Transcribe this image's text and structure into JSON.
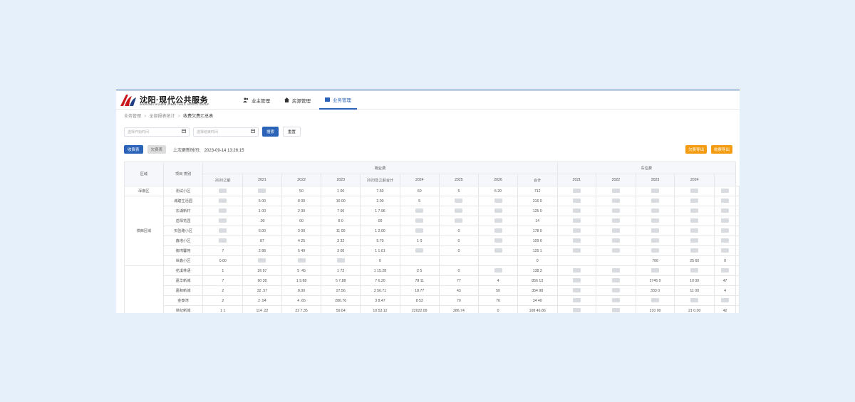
{
  "logo": {
    "cn": "沈阳·现代公共服务",
    "en": "SHENYANG MODERN URBAN PUBLIC SERVICE GROUP"
  },
  "nav": [
    {
      "label": "业主管理",
      "icon": "users-icon"
    },
    {
      "label": "房源管理",
      "icon": "house-icon"
    },
    {
      "label": "业务管理",
      "icon": "folder-icon",
      "active": true
    }
  ],
  "breadcrumb": [
    "业务管理",
    "全部报表统计",
    "收费欠费汇总表"
  ],
  "filter": {
    "start_placeholder": "选择开始时间",
    "end_placeholder": "选择结束时间",
    "search_label": "搜索",
    "reset_label": "重置"
  },
  "toolbar": {
    "tab_charge": "收费表",
    "tab_arrears": "欠费表",
    "updated": "上次更新时间： 2023-09-14 13:26:15",
    "export_arrears": "欠费导出",
    "export_charge": "收费导出"
  },
  "table": {
    "head_area": "区域",
    "head_project": "项目 类别",
    "group_property": "物业费",
    "group_parking": "车位费",
    "property_years": [
      "2020之前",
      "2021",
      "2022",
      "2023",
      "2023及之前合计",
      "2024",
      "2025",
      "2026",
      "合计"
    ],
    "parking_years": [
      "2021",
      "2022",
      "2023",
      "2024"
    ],
    "rows": [
      {
        "area": "浑南区",
        "project": "测试小区",
        "cells": [
          "",
          "",
          "50",
          "1 00",
          "7.50",
          "60 ",
          "5 ",
          "5 20",
          "712 ",
          "",
          "",
          "",
          "",
          ""
        ]
      },
      {
        "area": "",
        "project": "城建生活园",
        "cells": [
          "",
          "5 00",
          "8 00",
          "16 00",
          "2.00",
          "5 ",
          "",
          "",
          "316 0",
          "",
          "",
          "",
          "",
          ""
        ]
      },
      {
        "area": "",
        "project": "东湖新村",
        "cells": [
          "",
          "1 00",
          "2 00",
          "7 06",
          "1 7.96",
          "",
          "",
          "",
          "125 0",
          "",
          "",
          "",
          "",
          ""
        ]
      },
      {
        "area": "",
        "project": "岳阳花园",
        "cells": [
          "",
          ".00",
          "00",
          "8 0",
          "00",
          "",
          "",
          "",
          "14 ",
          "",
          "",
          "",
          "",
          ""
        ]
      },
      {
        "area": "铁西区域",
        "project": "实验路小区",
        "cells": [
          "",
          "6.00",
          "3 00",
          "11 00",
          "1 2.00",
          "",
          "0",
          "",
          "178 0",
          "",
          "",
          "",
          "",
          ""
        ]
      },
      {
        "area": "",
        "project": "鑫塔小区",
        "cells": [
          "",
          "87",
          "4 25",
          "3 32",
          "5.70",
          "1 0",
          "0",
          "",
          "109 0",
          "",
          "",
          "",
          "",
          ""
        ]
      },
      {
        "area": "",
        "project": "御湾馨苑",
        "cells": [
          "7",
          "2 88",
          "5 49",
          "3 00",
          "1 1.61",
          "",
          "0",
          "",
          "125 1",
          "",
          "",
          "",
          "",
          ""
        ]
      },
      {
        "area": "",
        "project": "世鑫小区",
        "cells": [
          "0.00",
          "",
          "",
          "",
          "0",
          "",
          "",
          "",
          "0",
          "",
          "",
          "706 ",
          "25 60",
          "0"
        ]
      },
      {
        "area": "",
        "project": "花溪林语",
        "cells": [
          "1",
          "26 97",
          "5 .45",
          "1 72",
          "1 15.28",
          "2 5",
          "0",
          "",
          "138 3",
          "",
          "",
          "",
          "",
          ""
        ]
      },
      {
        "area": "",
        "project": "嘉华新城",
        "cells": [
          "7",
          "90 38",
          "1 9.88",
          "5 7.88",
          "7 6.20",
          "78 11",
          "77",
          "4",
          "856 13",
          "",
          "",
          "2745 0",
          "10 00",
          "47"
        ]
      },
      {
        "area": "",
        "project": "嘉和新城",
        "cells": [
          "2",
          "32 .57",
          "8.00",
          "27.56",
          "3 56.71",
          "18 77",
          "43 ",
          "50",
          "354 98",
          "",
          "",
          "333 0",
          "11 00",
          "4"
        ]
      },
      {
        "area": "",
        "project": "金泰湾",
        "cells": [
          "2",
          "2 .94",
          "4 .65",
          "286.76",
          "3 8.47",
          "8 53",
          "70",
          "76",
          "34 40",
          "",
          "",
          "",
          "",
          ""
        ]
      },
      {
        "area": "",
        "project": "世纪新城",
        "cells": [
          "1 1",
          "114 .22",
          "22 7.35",
          "59.64",
          "10 53.12",
          "22022.09",
          "286.74",
          "0",
          "108 46.86",
          "",
          "",
          "210 00",
          "21 0.00",
          "42"
        ]
      }
    ]
  },
  "colors": {
    "accent": "#2b63b8",
    "orange": "#f39c12"
  }
}
